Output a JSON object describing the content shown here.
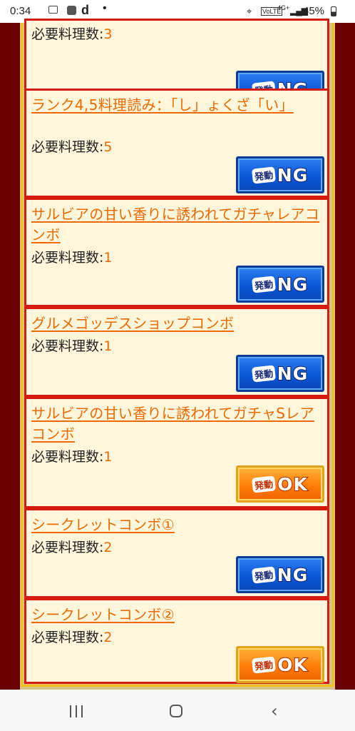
{
  "status_bar": {
    "time": "0:34",
    "app_letter": "d",
    "dot": "•",
    "network": "4G+",
    "volte": "VoLTE",
    "battery": "45%"
  },
  "cards": [
    {
      "title": "",
      "req_label": "必要料理数:",
      "req_value": "3",
      "status": "NG"
    },
    {
      "title": "ランク4,5料理読み：「し」ょくざ「い」",
      "req_label": "必要料理数:",
      "req_value": "5",
      "status": "NG"
    },
    {
      "title": "サルビアの甘い香りに誘われてガチャレアコンボ",
      "req_label": "必要料理数:",
      "req_value": "1",
      "status": "NG"
    },
    {
      "title": "グルメゴッデスショップコンボ",
      "req_label": "必要料理数:",
      "req_value": "1",
      "status": "NG"
    },
    {
      "title": "サルビアの甘い香りに誘われてガチャSレアコンボ",
      "req_label": "必要料理数:",
      "req_value": "1",
      "status": "OK"
    },
    {
      "title": "シークレットコンボ①",
      "req_label": "必要料理数:",
      "req_value": "2",
      "status": "NG"
    },
    {
      "title": "シークレットコンボ②",
      "req_label": "必要料理数:",
      "req_value": "2",
      "status": "OK"
    }
  ],
  "badge": {
    "small_label": "発動",
    "ng": "NG",
    "ok": "OK"
  },
  "colors": {
    "accent_orange": "#ec6a00",
    "card_border": "#d51a10",
    "frame_dark": "#6a0000",
    "frame_gold": "#f2c11a",
    "ng_blue": "#0a57d8",
    "ok_orange": "#ff7d0a"
  }
}
